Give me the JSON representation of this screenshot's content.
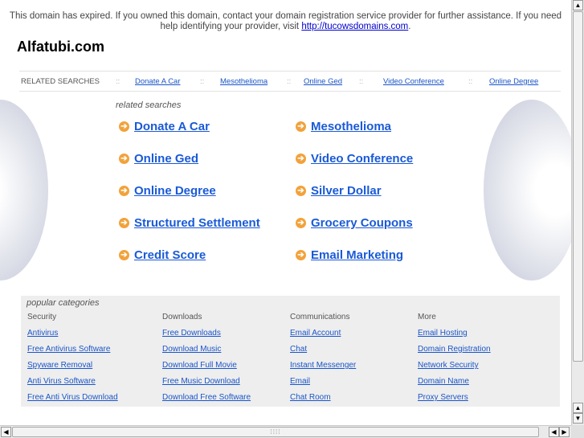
{
  "notice": {
    "text_before": "This domain has expired. If you owned this domain, contact your domain registration service provider for further assistance. If you need help identifying your provider, visit ",
    "link": "http://tucowsdomains.com",
    "text_after": "."
  },
  "site_title": "Alfatubi.com",
  "related_bar": {
    "label": "RELATED SEARCHES",
    "separator": "::",
    "links": [
      "Donate A Car",
      "Mesothelioma",
      "Online Ged",
      "Video Conference",
      "Online Degree"
    ]
  },
  "related": {
    "heading": "related searches",
    "left": [
      "Donate A Car",
      "Online Ged",
      "Online Degree",
      "Structured Settlement",
      "Credit Score"
    ],
    "right": [
      "Mesothelioma",
      "Video Conference",
      "Silver Dollar",
      "Grocery Coupons",
      "Email Marketing"
    ]
  },
  "popular": {
    "heading": "popular categories",
    "columns": [
      {
        "header": "Security",
        "links": [
          "Antivirus",
          "Free Antivirus Software",
          "Spyware Removal",
          "Anti Virus Software",
          "Free Anti Virus Download"
        ]
      },
      {
        "header": "Downloads",
        "links": [
          "Free Downloads",
          "Download Music",
          "Download Full Movie",
          "Free Music Download",
          "Download Free Software"
        ]
      },
      {
        "header": "Communications",
        "links": [
          "Email Account",
          "Chat",
          "Instant Messenger",
          "Email",
          "Chat Room"
        ]
      },
      {
        "header": "More",
        "links": [
          "Email Hosting",
          "Domain Registration",
          "Network Security",
          "Domain Name",
          "Proxy Servers"
        ]
      }
    ]
  },
  "icons": {
    "result_bullet": "arrow-circle-icon"
  },
  "colors": {
    "link": "#1a5ad6",
    "bullet": "#f2a23b",
    "popular_bg": "#eeeeee"
  }
}
